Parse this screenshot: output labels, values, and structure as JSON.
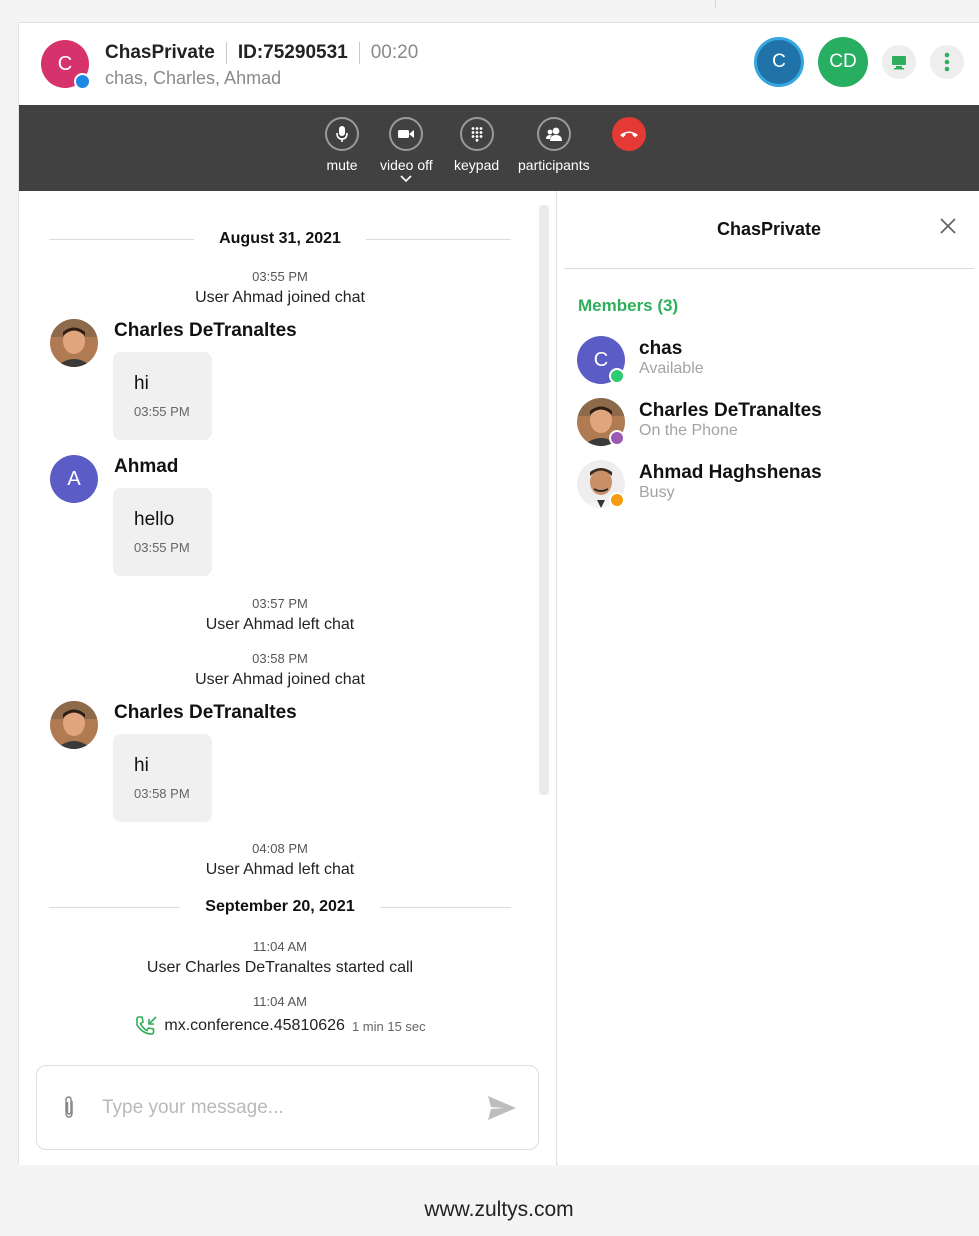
{
  "header": {
    "avatar_letter": "C",
    "title": "ChasPrivate",
    "id": "ID:75290531",
    "timer": "00:20",
    "members_line": "chas, Charles, Ahmad",
    "participant_avatars": [
      "C",
      "CD"
    ]
  },
  "toolbar": {
    "mute": "mute",
    "video_off": "video off",
    "keypad": "keypad",
    "participants": "participants"
  },
  "chat": {
    "dates": [
      "August 31, 2021",
      "September 20, 2021"
    ],
    "events": [
      {
        "time": "03:55 PM",
        "text": "User Ahmad joined chat"
      },
      {
        "time": "03:57 PM",
        "text": "User Ahmad left chat"
      },
      {
        "time": "03:58 PM",
        "text": "User Ahmad joined chat"
      },
      {
        "time": "04:08 PM",
        "text": "User Ahmad left chat"
      },
      {
        "time": "11:04 AM",
        "text": "User Charles DeTranaltes started call"
      }
    ],
    "messages": [
      {
        "sender": "Charles DeTranaltes",
        "text": "hi",
        "time": "03:55 PM"
      },
      {
        "sender": "Ahmad",
        "avatar_letter": "A",
        "text": "hello",
        "time": "03:55 PM"
      },
      {
        "sender": "Charles DeTranaltes",
        "text": "hi",
        "time": "03:58 PM"
      }
    ],
    "call": {
      "time": "11:04 AM",
      "name": "mx.conference.45810626",
      "duration": "1 min 15 sec"
    },
    "input_placeholder": "Type your message..."
  },
  "members": {
    "title": "ChasPrivate",
    "count_label": "Members (3)",
    "list": [
      {
        "name": "chas",
        "status": "Available",
        "avatar_letter": "C",
        "status_color": "#2ecc71"
      },
      {
        "name": "Charles DeTranaltes",
        "status": "On the Phone",
        "status_color": "#9b59b6"
      },
      {
        "name": "Ahmad Haghshenas",
        "status": "Busy",
        "status_color": "#f39c12"
      }
    ]
  },
  "footer": "www.zultys.com"
}
